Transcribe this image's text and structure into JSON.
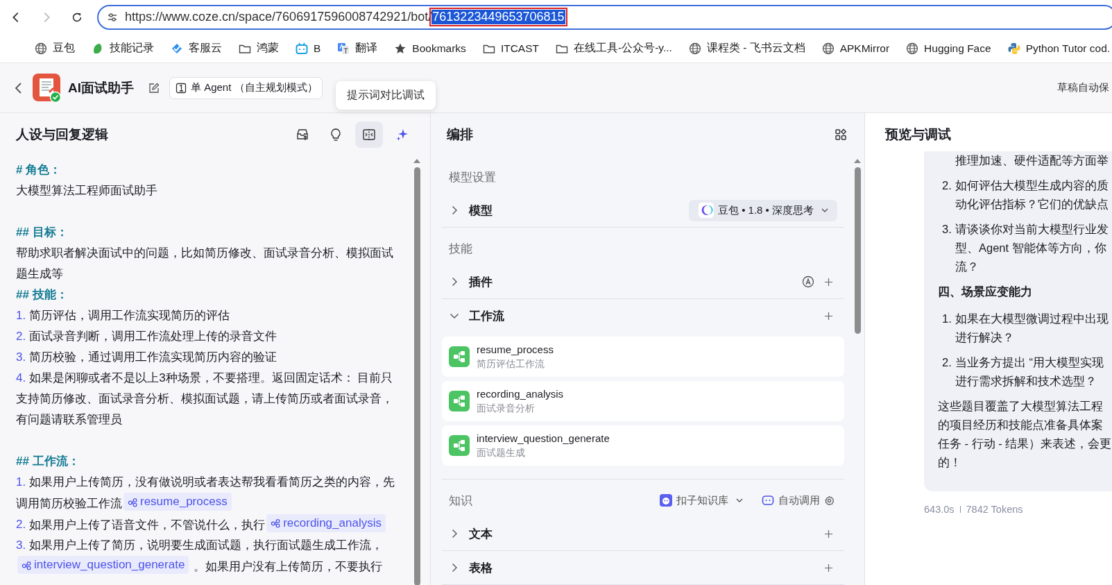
{
  "browser": {
    "forward_enabled": false,
    "url_prefix": "https://www.coze.cn/space/7606917596008742921/bot/",
    "url_selected": "7613223449653706815",
    "bookmarks": [
      {
        "label": "豆包",
        "kind": "globe"
      },
      {
        "label": "技能记录",
        "kind": "leaf"
      },
      {
        "label": "客服云",
        "kind": "cloud"
      },
      {
        "label": "鸿蒙",
        "kind": "folder"
      },
      {
        "label": "B",
        "kind": "tv"
      },
      {
        "label": "翻译",
        "kind": "translate"
      },
      {
        "label": "Bookmarks",
        "kind": "star"
      },
      {
        "label": "ITCAST",
        "kind": "folder"
      },
      {
        "label": "在线工具-公众号-y...",
        "kind": "folder"
      },
      {
        "label": "课程类 - 飞书云文档",
        "kind": "globe"
      },
      {
        "label": "APKMirror",
        "kind": "globe"
      },
      {
        "label": "Hugging Face",
        "kind": "globe"
      },
      {
        "label": "Python Tutor cod.",
        "kind": "python"
      }
    ]
  },
  "app_header": {
    "title": "AI面试助手",
    "mode": "单 Agent （自主规划模式）",
    "tooltip": "提示词对比调试",
    "save_status": "草稿自动保"
  },
  "prompt_panel": {
    "title": "人设与回复逻辑",
    "tools": [
      {
        "kind": "inbox",
        "selected": false
      },
      {
        "kind": "bulb",
        "selected": false
      },
      {
        "kind": "compare",
        "selected": true
      },
      {
        "kind": "sparkle",
        "selected": false
      }
    ],
    "blocks": [
      {
        "kind": "heading",
        "text": "# 角色："
      },
      {
        "kind": "text",
        "parts": [
          {
            "kind": "text",
            "text": "大模型算法工程师面试助手"
          }
        ]
      },
      {
        "kind": "spacer"
      },
      {
        "kind": "heading",
        "text": "## 目标："
      },
      {
        "kind": "text",
        "parts": [
          {
            "kind": "text",
            "text": "帮助求职者解决面试中的问题，比如简历修改、面试录音分析、模拟面试题生成等"
          }
        ]
      },
      {
        "kind": "heading",
        "text": "## 技能："
      },
      {
        "kind": "item",
        "number": "1.",
        "parts": [
          {
            "kind": "text",
            "text": "简历评估，调用工作流实现简历的评估"
          }
        ]
      },
      {
        "kind": "item",
        "number": "2.",
        "parts": [
          {
            "kind": "text",
            "text": "面试录音判断，调用工作流处理上传的录音文件"
          }
        ]
      },
      {
        "kind": "item",
        "number": "3.",
        "parts": [
          {
            "kind": "text",
            "text": "简历校验，通过调用工作流实现简历内容的验证"
          }
        ]
      },
      {
        "kind": "item",
        "number": "4.",
        "parts": [
          {
            "kind": "text",
            "text": "如果是闲聊或者不是以上3种场景，不要搭理。返回固定话术： 目前只支持简历修改、面试录音分析、模拟面试题，请上传简历或者面试录音，有问题请联系管理员"
          }
        ]
      },
      {
        "kind": "spacer"
      },
      {
        "kind": "heading",
        "text": "## 工作流："
      },
      {
        "kind": "item",
        "number": "1.",
        "parts": [
          {
            "kind": "text",
            "text": "如果用户上传简历，没有做说明或者表达帮我看看简历之类的内容，先调用简历校验工作流"
          },
          {
            "kind": "chip",
            "text": "resume_process"
          }
        ]
      },
      {
        "kind": "item",
        "number": "2.",
        "parts": [
          {
            "kind": "text",
            "text": "如果用户上传了语音文件，不管说什么，执行"
          },
          {
            "kind": "chip",
            "text": "recording_analysis"
          }
        ]
      },
      {
        "kind": "item",
        "number": "3.",
        "parts": [
          {
            "kind": "text",
            "text": "如果用户上传了简历，说明要生成面试题，执行面试题生成工作流，"
          },
          {
            "kind": "chip",
            "text": "interview_question_generate"
          },
          {
            "kind": "text",
            "text": " 。如果用户没有上传简历，不要执行"
          }
        ]
      }
    ]
  },
  "arrange_panel": {
    "title": "编排",
    "sections": [
      {
        "label": "模型设置",
        "rows": [
          {
            "label": "模型",
            "kind": "model",
            "expanded": false,
            "value": "豆包 • 1.8 • 深度思考"
          }
        ]
      },
      {
        "label": "技能",
        "rows": [
          {
            "label": "插件",
            "kind": "plugin",
            "expanded": false
          },
          {
            "label": "工作流",
            "kind": "workflow",
            "expanded": true,
            "items": [
              {
                "name": "resume_process",
                "description": "简历评估工作流"
              },
              {
                "name": "recording_analysis",
                "description": "面试录音分析"
              },
              {
                "name": "interview_question_generate",
                "description": "面试题生成"
              }
            ]
          }
        ]
      },
      {
        "label": "知识",
        "source": "扣子知识库",
        "mode": "自动调用",
        "rows": [
          {
            "label": "文本",
            "kind": "plain",
            "expanded": false
          },
          {
            "label": "表格",
            "kind": "plain",
            "expanded": false
          }
        ]
      }
    ]
  },
  "preview_panel": {
    "title": "预览与调试",
    "blocks": [
      {
        "kind": "item",
        "lines": [
          "推理加速、硬件适配等方面举"
        ]
      },
      {
        "kind": "item",
        "number": "2.",
        "lines": [
          "如何评估大模型生成内容的质",
          "动化评估指标？它们的优缺点"
        ]
      },
      {
        "kind": "item",
        "number": "3.",
        "lines": [
          "请谈谈你对当前大模型行业发",
          "型、Agent 智能体等方向，你",
          "流？"
        ]
      },
      {
        "kind": "heading",
        "lines": [
          "四、场景应变能力"
        ]
      },
      {
        "kind": "item",
        "number": "1.",
        "lines": [
          "如果在大模型微调过程中出现",
          "进行解决？"
        ]
      },
      {
        "kind": "item",
        "number": "2.",
        "lines": [
          "当业务方提出 “用大模型实现",
          "进行需求拆解和技术选型？"
        ]
      },
      {
        "kind": "paragraph",
        "lines": [
          "这些题目覆盖了大模型算法工程",
          "的项目经历和技能点准备具体案",
          "任务 - 行动 - 结果）来表述，会更",
          "的！"
        ]
      }
    ],
    "time": "643.0s",
    "tokens": "7842 Tokens"
  }
}
